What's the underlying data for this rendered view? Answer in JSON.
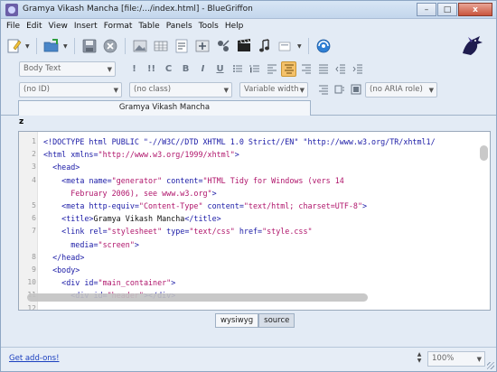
{
  "window": {
    "title": "Gramya Vikash Mancha [file:/.../index.html] - BlueGriffon",
    "minimize": "–",
    "maximize": "□",
    "close": "x"
  },
  "menu": [
    "File",
    "Edit",
    "View",
    "Insert",
    "Format",
    "Table",
    "Panels",
    "Tools",
    "Help"
  ],
  "toolbar": {
    "icons": [
      "new-document-icon",
      "open-document-icon",
      "save-icon",
      "close-document-icon",
      "image-icon",
      "link-icon",
      "anchor-icon",
      "video-icon",
      "audio-icon",
      "form-icon",
      "preview-icon"
    ]
  },
  "format_bar": {
    "paragraph_style": "Body Text",
    "buttons": [
      "!",
      "!!",
      "C",
      "B",
      "I",
      "U"
    ]
  },
  "id_bar": {
    "id": "(no ID)",
    "class": "(no class)",
    "width": "Variable width",
    "aria": "(no ARIA role)"
  },
  "doc_tab": {
    "label": "Gramya Vikash Mancha"
  },
  "structure": {
    "label": "z"
  },
  "editor": {
    "line_numbers": [
      "1",
      "2",
      "3",
      "4",
      "",
      "5",
      "6",
      "7",
      "",
      "8",
      "9",
      "10",
      "11",
      "12",
      "13"
    ],
    "lines": [
      {
        "indent": "",
        "parts": [
          [
            "tag",
            "<!DOCTYPE html PUBLIC \"-//W3C//DTD XHTML 1.0 Strict//EN\" \"http://www.w3.org/TR/xhtml1/"
          ]
        ]
      },
      {
        "indent": "",
        "parts": [
          [
            "tag",
            "<html "
          ],
          [
            "attr",
            "xmlns="
          ],
          [
            "val",
            "\"http://www.w3.org/1999/xhtml\""
          ],
          [
            "tag",
            ">"
          ]
        ]
      },
      {
        "indent": "  ",
        "parts": [
          [
            "tag",
            "<head>"
          ]
        ]
      },
      {
        "indent": "    ",
        "parts": [
          [
            "tag",
            "<meta "
          ],
          [
            "attr",
            "name="
          ],
          [
            "val",
            "\"generator\""
          ],
          [
            "attr",
            " content="
          ],
          [
            "val",
            "\"HTML Tidy for Windows (vers 14"
          ]
        ]
      },
      {
        "indent": "      ",
        "parts": [
          [
            "val",
            "February 2006), see www.w3.org\""
          ],
          [
            "tag",
            ">"
          ]
        ]
      },
      {
        "indent": "    ",
        "parts": [
          [
            "tag",
            "<meta "
          ],
          [
            "attr",
            "http-equiv="
          ],
          [
            "val",
            "\"Content-Type\""
          ],
          [
            "attr",
            " content="
          ],
          [
            "val",
            "\"text/html; charset=UTF-8\""
          ],
          [
            "tag",
            ">"
          ]
        ]
      },
      {
        "indent": "    ",
        "parts": [
          [
            "tag",
            "<title>"
          ],
          [
            "txt",
            "Gramya Vikash Mancha"
          ],
          [
            "tag",
            "</title>"
          ]
        ]
      },
      {
        "indent": "    ",
        "parts": [
          [
            "tag",
            "<link "
          ],
          [
            "attr",
            "rel="
          ],
          [
            "val",
            "\"stylesheet\""
          ],
          [
            "attr",
            " type="
          ],
          [
            "val",
            "\"text/css\""
          ],
          [
            "attr",
            " href="
          ],
          [
            "val",
            "\"style.css\""
          ]
        ]
      },
      {
        "indent": "      ",
        "parts": [
          [
            "attr",
            "media="
          ],
          [
            "val",
            "\"screen\""
          ],
          [
            "tag",
            ">"
          ]
        ]
      },
      {
        "indent": "  ",
        "parts": [
          [
            "tag",
            "</head>"
          ]
        ]
      },
      {
        "indent": "  ",
        "parts": [
          [
            "tag",
            "<body>"
          ]
        ]
      },
      {
        "indent": "    ",
        "parts": [
          [
            "tag",
            "<div "
          ],
          [
            "attr",
            "id="
          ],
          [
            "val",
            "\"main_container\""
          ],
          [
            "tag",
            ">"
          ]
        ]
      },
      {
        "indent": "      ",
        "parts": [
          [
            "tag",
            "<div "
          ],
          [
            "attr",
            "id="
          ],
          [
            "val",
            "\"header\""
          ],
          [
            "tag",
            "></div>"
          ]
        ]
      }
    ]
  },
  "mode_switch": {
    "wysiwyg": "wysiwyg",
    "source": "source"
  },
  "status": {
    "addons_link": "Get add-ons!",
    "zoom": "100%"
  }
}
